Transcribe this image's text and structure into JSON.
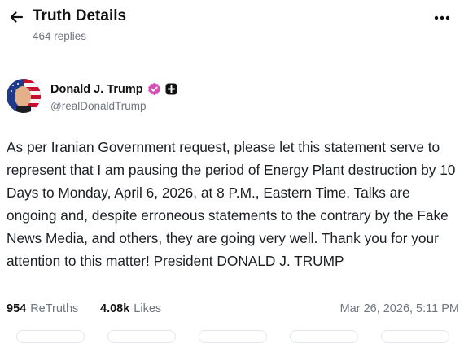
{
  "header": {
    "title": "Truth Details",
    "replies": "464 replies"
  },
  "author": {
    "name": "Donald J. Trump",
    "handle": "@realDonaldTrump"
  },
  "post": {
    "text": "As per Iranian Government request, please let this statement serve to represent that I am pausing the period of Energy Plant destruction by 10 Days to Monday, April 6, 2026, at 8 P.M., Eastern Time. Talks are ongoing and, despite erroneous statements to the contrary by the Fake News Media, and others, they are going very well. Thank you for your attention to this matter! President DONALD J. TRUMP"
  },
  "stats": {
    "retruths_count": "954",
    "retruths_label": "ReTruths",
    "likes_count": "4.08k",
    "likes_label": "Likes",
    "timestamp": "Mar 26, 2026, 5:11 PM"
  },
  "icons": {
    "back": "arrow-left-icon",
    "more": "more-horizontal-icon",
    "verified": "verified-badge-icon",
    "plus": "plus-badge-icon"
  },
  "colors": {
    "verified_badge": "#d24fb6",
    "secondary_text": "#6f7680"
  }
}
